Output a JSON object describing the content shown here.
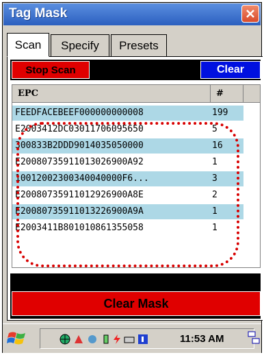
{
  "window": {
    "title": "Tag Mask"
  },
  "tabs": [
    {
      "label": "Scan",
      "active": true
    },
    {
      "label": "Specify",
      "active": false
    },
    {
      "label": "Presets",
      "active": false
    }
  ],
  "toolbar": {
    "stop_scan_label": "Stop Scan",
    "clear_label": "Clear"
  },
  "table": {
    "columns": [
      "EPC",
      "#"
    ],
    "rows": [
      {
        "epc": "FEEDFACEBEEF000000000008",
        "count": "199"
      },
      {
        "epc": "E2003412DC03011706095650",
        "count": "5"
      },
      {
        "epc": "300833B2DDD9014035050000",
        "count": "16"
      },
      {
        "epc": "E20080735911013026900A92",
        "count": "1"
      },
      {
        "epc": "10012002300340040000F6...",
        "count": "3"
      },
      {
        "epc": "E20080735911012926900A8E",
        "count": "2"
      },
      {
        "epc": "E20080735911013226900A9A",
        "count": "1"
      },
      {
        "epc": "E2003411B801010861355058",
        "count": "1"
      }
    ]
  },
  "clear_mask_label": "Clear Mask",
  "taskbar": {
    "clock": "11:53 AM"
  },
  "colors": {
    "accent_red": "#e00000",
    "accent_blue": "#0010e0",
    "row_highlight": "#add8e6",
    "title_blue": "#2b5fbf"
  }
}
